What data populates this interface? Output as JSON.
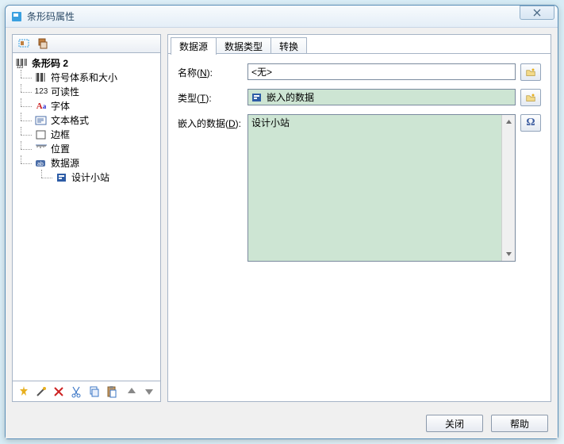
{
  "window": {
    "title": "条形码属性"
  },
  "tree": {
    "root": "条形码 2",
    "items": [
      {
        "label": "符号体系和大小"
      },
      {
        "label": "可读性"
      },
      {
        "label": "字体"
      },
      {
        "label": "文本格式"
      },
      {
        "label": "边框"
      },
      {
        "label": "位置"
      },
      {
        "label": "数据源",
        "child": {
          "label": "设计小站"
        }
      }
    ]
  },
  "tabs": [
    "数据源",
    "数据类型",
    "转换"
  ],
  "active_tab": 0,
  "form": {
    "name_label_pre": "名称(",
    "name_label_u": "N",
    "name_label_post": "):",
    "name_value": "<无>",
    "type_label_pre": "类型(",
    "type_label_u": "T",
    "type_label_post": "):",
    "type_value": "嵌入的数据",
    "embed_label_pre": "嵌入的数据(",
    "embed_label_u": "D",
    "embed_label_post": "):",
    "embed_value": "设计小站",
    "omega": "Ω"
  },
  "buttons": {
    "close": "关闭",
    "help": "帮助"
  }
}
